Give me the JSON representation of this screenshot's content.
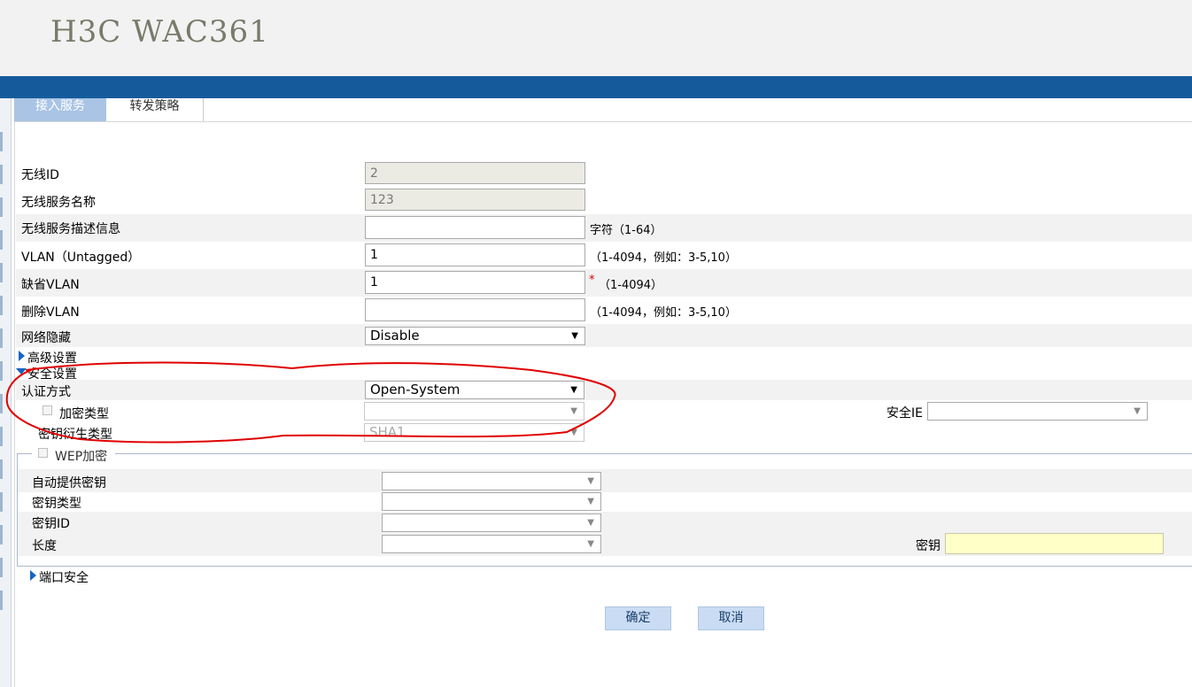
{
  "header": {
    "brand": "H3C WAC361"
  },
  "tabs": [
    {
      "label": "接入服务"
    },
    {
      "label": "转发策略"
    }
  ],
  "form": {
    "wireless_id": {
      "label": "无线ID",
      "value": "2"
    },
    "service_name": {
      "label": "无线服务名称",
      "value": "123"
    },
    "service_desc": {
      "label": "无线服务描述信息",
      "value": "",
      "hint": "字符（1-64）"
    },
    "vlan_untagged": {
      "label": "VLAN（Untagged）",
      "value": "1",
      "hint": "（1-4094，例如：3-5,10）"
    },
    "default_vlan": {
      "label": "缺省VLAN",
      "value": "1",
      "required": "*",
      "hint": "（1-4094）"
    },
    "delete_vlan": {
      "label": "删除VLAN",
      "value": "",
      "hint": "（1-4094，例如：3-5,10）"
    },
    "network_hide": {
      "label": "网络隐藏",
      "value": "Disable"
    }
  },
  "sections": {
    "advanced": "高级设置",
    "security": "安全设置",
    "port_security": "端口安全"
  },
  "security": {
    "auth_mode": {
      "label": "认证方式",
      "value": "Open-System"
    },
    "cipher_type": {
      "label": "加密类型",
      "value": ""
    },
    "security_ie": {
      "label": "安全IE",
      "value": ""
    },
    "key_derivation": {
      "label": "密钥衍生类型",
      "value": "SHA1"
    }
  },
  "wep": {
    "legend": "WEP加密",
    "auto_key": {
      "label": "自动提供密钥",
      "value": ""
    },
    "key_type": {
      "label": "密钥类型",
      "value": ""
    },
    "key_id": {
      "label": "密钥ID",
      "value": ""
    },
    "length": {
      "label": "长度",
      "value": ""
    },
    "key": {
      "label": "密钥",
      "value": ""
    }
  },
  "buttons": {
    "ok": "确定",
    "cancel": "取消"
  },
  "colors": {
    "header_bar": "#155b9c",
    "tab_active": "#a9c4e4",
    "button": "#c9dcf3",
    "key_field": "#ffffc8",
    "annotation": "#e00000"
  }
}
